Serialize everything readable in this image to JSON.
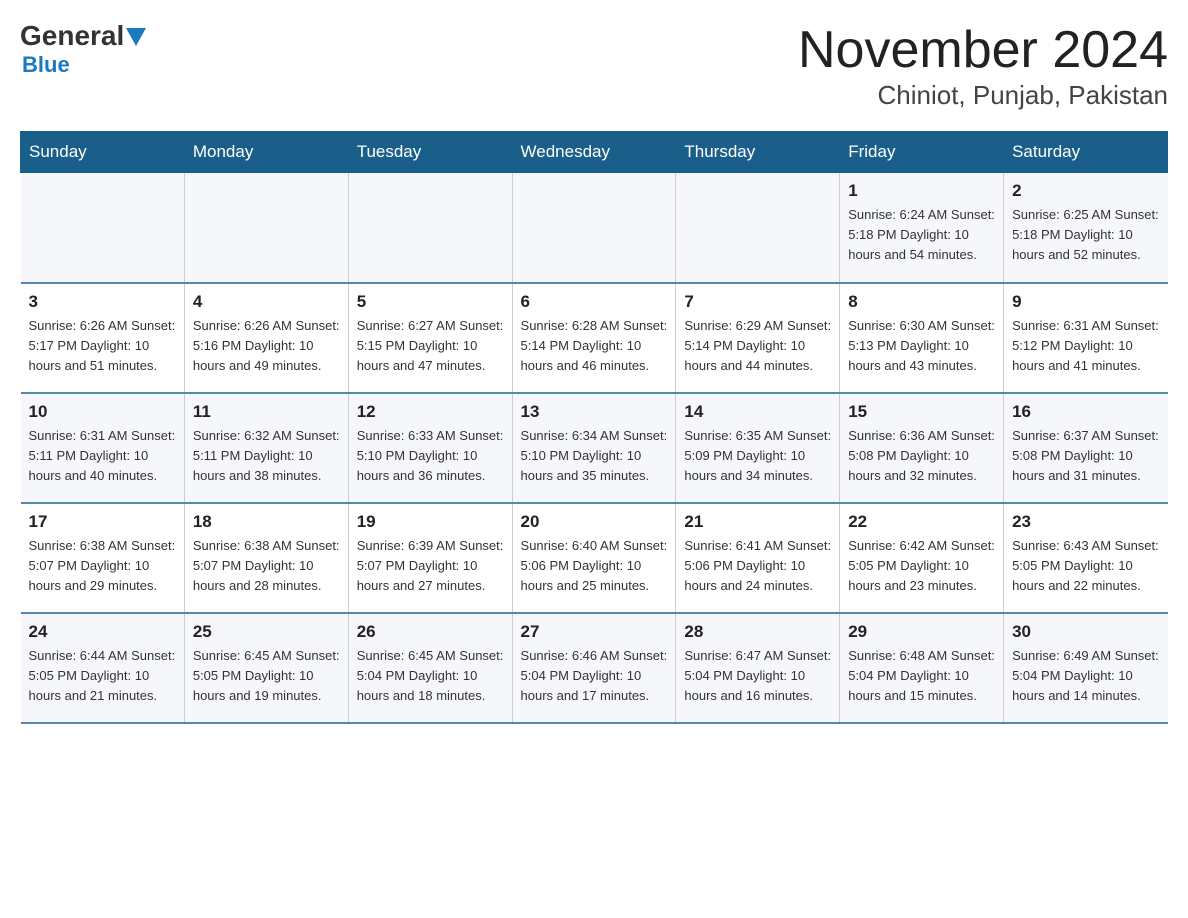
{
  "header": {
    "logo_general": "General",
    "logo_blue": "Blue",
    "month_title": "November 2024",
    "location": "Chiniot, Punjab, Pakistan"
  },
  "weekdays": [
    "Sunday",
    "Monday",
    "Tuesday",
    "Wednesday",
    "Thursday",
    "Friday",
    "Saturday"
  ],
  "weeks": [
    [
      {
        "day": "",
        "info": ""
      },
      {
        "day": "",
        "info": ""
      },
      {
        "day": "",
        "info": ""
      },
      {
        "day": "",
        "info": ""
      },
      {
        "day": "",
        "info": ""
      },
      {
        "day": "1",
        "info": "Sunrise: 6:24 AM\nSunset: 5:18 PM\nDaylight: 10 hours and 54 minutes."
      },
      {
        "day": "2",
        "info": "Sunrise: 6:25 AM\nSunset: 5:18 PM\nDaylight: 10 hours and 52 minutes."
      }
    ],
    [
      {
        "day": "3",
        "info": "Sunrise: 6:26 AM\nSunset: 5:17 PM\nDaylight: 10 hours and 51 minutes."
      },
      {
        "day": "4",
        "info": "Sunrise: 6:26 AM\nSunset: 5:16 PM\nDaylight: 10 hours and 49 minutes."
      },
      {
        "day": "5",
        "info": "Sunrise: 6:27 AM\nSunset: 5:15 PM\nDaylight: 10 hours and 47 minutes."
      },
      {
        "day": "6",
        "info": "Sunrise: 6:28 AM\nSunset: 5:14 PM\nDaylight: 10 hours and 46 minutes."
      },
      {
        "day": "7",
        "info": "Sunrise: 6:29 AM\nSunset: 5:14 PM\nDaylight: 10 hours and 44 minutes."
      },
      {
        "day": "8",
        "info": "Sunrise: 6:30 AM\nSunset: 5:13 PM\nDaylight: 10 hours and 43 minutes."
      },
      {
        "day": "9",
        "info": "Sunrise: 6:31 AM\nSunset: 5:12 PM\nDaylight: 10 hours and 41 minutes."
      }
    ],
    [
      {
        "day": "10",
        "info": "Sunrise: 6:31 AM\nSunset: 5:11 PM\nDaylight: 10 hours and 40 minutes."
      },
      {
        "day": "11",
        "info": "Sunrise: 6:32 AM\nSunset: 5:11 PM\nDaylight: 10 hours and 38 minutes."
      },
      {
        "day": "12",
        "info": "Sunrise: 6:33 AM\nSunset: 5:10 PM\nDaylight: 10 hours and 36 minutes."
      },
      {
        "day": "13",
        "info": "Sunrise: 6:34 AM\nSunset: 5:10 PM\nDaylight: 10 hours and 35 minutes."
      },
      {
        "day": "14",
        "info": "Sunrise: 6:35 AM\nSunset: 5:09 PM\nDaylight: 10 hours and 34 minutes."
      },
      {
        "day": "15",
        "info": "Sunrise: 6:36 AM\nSunset: 5:08 PM\nDaylight: 10 hours and 32 minutes."
      },
      {
        "day": "16",
        "info": "Sunrise: 6:37 AM\nSunset: 5:08 PM\nDaylight: 10 hours and 31 minutes."
      }
    ],
    [
      {
        "day": "17",
        "info": "Sunrise: 6:38 AM\nSunset: 5:07 PM\nDaylight: 10 hours and 29 minutes."
      },
      {
        "day": "18",
        "info": "Sunrise: 6:38 AM\nSunset: 5:07 PM\nDaylight: 10 hours and 28 minutes."
      },
      {
        "day": "19",
        "info": "Sunrise: 6:39 AM\nSunset: 5:07 PM\nDaylight: 10 hours and 27 minutes."
      },
      {
        "day": "20",
        "info": "Sunrise: 6:40 AM\nSunset: 5:06 PM\nDaylight: 10 hours and 25 minutes."
      },
      {
        "day": "21",
        "info": "Sunrise: 6:41 AM\nSunset: 5:06 PM\nDaylight: 10 hours and 24 minutes."
      },
      {
        "day": "22",
        "info": "Sunrise: 6:42 AM\nSunset: 5:05 PM\nDaylight: 10 hours and 23 minutes."
      },
      {
        "day": "23",
        "info": "Sunrise: 6:43 AM\nSunset: 5:05 PM\nDaylight: 10 hours and 22 minutes."
      }
    ],
    [
      {
        "day": "24",
        "info": "Sunrise: 6:44 AM\nSunset: 5:05 PM\nDaylight: 10 hours and 21 minutes."
      },
      {
        "day": "25",
        "info": "Sunrise: 6:45 AM\nSunset: 5:05 PM\nDaylight: 10 hours and 19 minutes."
      },
      {
        "day": "26",
        "info": "Sunrise: 6:45 AM\nSunset: 5:04 PM\nDaylight: 10 hours and 18 minutes."
      },
      {
        "day": "27",
        "info": "Sunrise: 6:46 AM\nSunset: 5:04 PM\nDaylight: 10 hours and 17 minutes."
      },
      {
        "day": "28",
        "info": "Sunrise: 6:47 AM\nSunset: 5:04 PM\nDaylight: 10 hours and 16 minutes."
      },
      {
        "day": "29",
        "info": "Sunrise: 6:48 AM\nSunset: 5:04 PM\nDaylight: 10 hours and 15 minutes."
      },
      {
        "day": "30",
        "info": "Sunrise: 6:49 AM\nSunset: 5:04 PM\nDaylight: 10 hours and 14 minutes."
      }
    ]
  ]
}
